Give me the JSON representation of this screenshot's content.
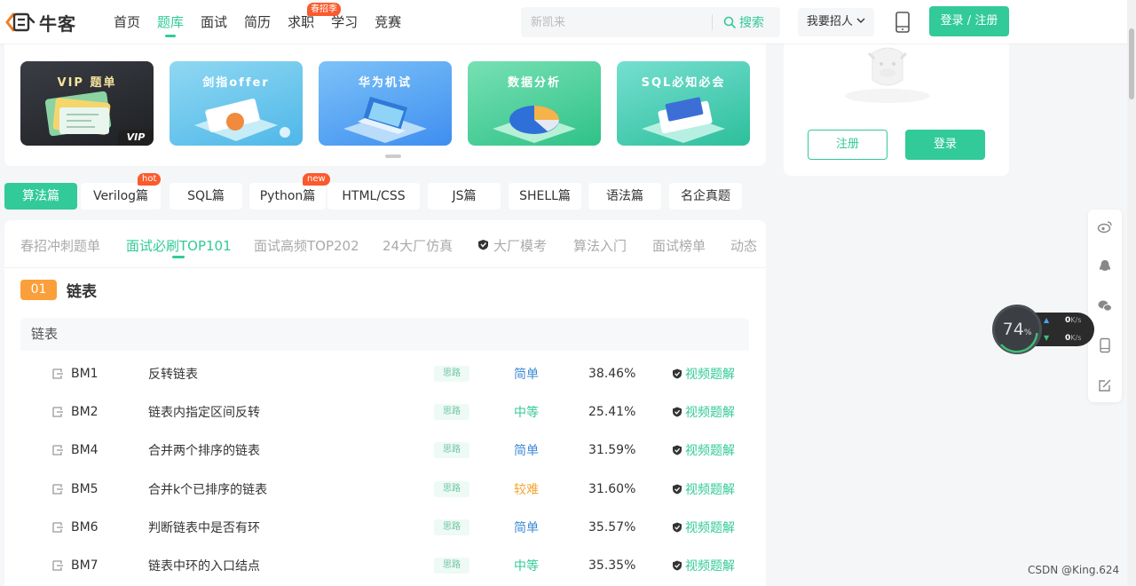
{
  "header": {
    "logo_text": "牛客",
    "nav": [
      {
        "label": "首页",
        "active": false,
        "badge": ""
      },
      {
        "label": "题库",
        "active": true,
        "badge": ""
      },
      {
        "label": "面试",
        "active": false,
        "badge": ""
      },
      {
        "label": "简历",
        "active": false,
        "badge": ""
      },
      {
        "label": "求职",
        "active": false,
        "badge": "春招季"
      },
      {
        "label": "学习",
        "active": false,
        "badge": ""
      },
      {
        "label": "竞赛",
        "active": false,
        "badge": ""
      }
    ],
    "search_placeholder": "新凯来",
    "search_button": "搜索",
    "recruit_label": "我要招人",
    "login_label": "登录 / 注册"
  },
  "banner": {
    "cards": [
      {
        "title": "VIP 题单",
        "tag": "VIP"
      },
      {
        "title": "剑指offer"
      },
      {
        "title": "华为机试"
      },
      {
        "title": "数据分析"
      },
      {
        "title": "SQL必知必会"
      }
    ]
  },
  "user_panel": {
    "register_label": "注册",
    "login_label": "登录"
  },
  "categories": [
    {
      "label": "算法篇",
      "active": true,
      "badge": ""
    },
    {
      "label": "Verilog篇",
      "active": false,
      "badge": "hot"
    },
    {
      "label": "SQL篇",
      "active": false,
      "badge": ""
    },
    {
      "label": "Python篇",
      "active": false,
      "badge": "new"
    },
    {
      "label": "HTML/CSS",
      "active": false,
      "badge": ""
    },
    {
      "label": "JS篇",
      "active": false,
      "badge": ""
    },
    {
      "label": "SHELL篇",
      "active": false,
      "badge": ""
    },
    {
      "label": "语法篇",
      "active": false,
      "badge": ""
    },
    {
      "label": "名企真题",
      "active": false,
      "badge": ""
    }
  ],
  "sub_tabs": [
    {
      "label": "春招冲刺题单",
      "active": false
    },
    {
      "label": "面试必刷TOP101",
      "active": true
    },
    {
      "label": "面试高频TOP202",
      "active": false
    },
    {
      "label": "24大厂仿真",
      "active": false
    },
    {
      "label": "大厂模考",
      "active": false,
      "icon": "vip-shield-icon"
    },
    {
      "label": "算法入门",
      "active": false
    },
    {
      "label": "面试榜单",
      "active": false
    },
    {
      "label": "动态",
      "active": false
    }
  ],
  "section": {
    "number": "01",
    "title": "链表",
    "group": "链表"
  },
  "problems": [
    {
      "id": "BM1",
      "title": "反转链表",
      "tag": "思路",
      "difficulty": "简单",
      "level": "easy",
      "rate": "38.46%",
      "video": "视频题解"
    },
    {
      "id": "BM2",
      "title": "链表内指定区间反转",
      "tag": "思路",
      "difficulty": "中等",
      "level": "mid",
      "rate": "25.41%",
      "video": "视频题解"
    },
    {
      "id": "BM4",
      "title": "合并两个排序的链表",
      "tag": "思路",
      "difficulty": "简单",
      "level": "easy",
      "rate": "31.59%",
      "video": "视频题解"
    },
    {
      "id": "BM5",
      "title": "合并k个已排序的链表",
      "tag": "思路",
      "difficulty": "较难",
      "level": "hard",
      "rate": "31.60%",
      "video": "视频题解"
    },
    {
      "id": "BM6",
      "title": "判断链表中是否有环",
      "tag": "思路",
      "difficulty": "简单",
      "level": "easy",
      "rate": "35.57%",
      "video": "视频题解"
    },
    {
      "id": "BM7",
      "title": "链表中环的入口结点",
      "tag": "思路",
      "difficulty": "中等",
      "level": "mid",
      "rate": "35.35%",
      "video": "视频题解"
    }
  ],
  "side_tools": [
    "weibo-icon",
    "qq-icon",
    "wechat-icon",
    "mobile-icon",
    "feedback-icon"
  ],
  "speed_widget": {
    "percent": "74",
    "percent_unit": "%",
    "up": "0",
    "down": "0",
    "unit": "K/s"
  },
  "watermark": "CSDN @King.624",
  "colors": {
    "brand": "#32ca99",
    "badge": "#fa5a2d",
    "easy": "#3d8bd6",
    "mid": "#32ca99",
    "hard": "#f3a633",
    "section_number": "#fb9f3a"
  }
}
